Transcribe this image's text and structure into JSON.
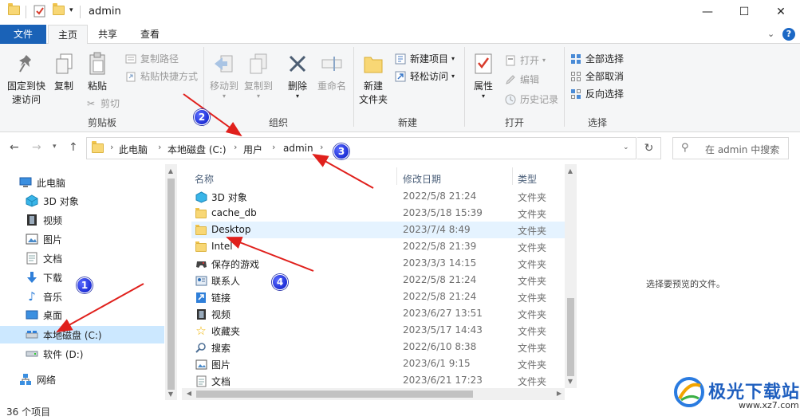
{
  "window": {
    "title": "admin",
    "controls": {
      "minimize": "—",
      "maximize": "☐",
      "close": "✕"
    }
  },
  "tabs": {
    "file": "文件",
    "home": "主页",
    "share": "共享",
    "view": "查看",
    "help": "?"
  },
  "ribbon": {
    "clipboard": {
      "pin": "固定到快\n速访问",
      "pin_l1": "固定到快",
      "pin_l2": "速访问",
      "copy": "复制",
      "paste": "粘贴",
      "copy_path": "复制路径",
      "paste_shortcut": "粘贴快捷方式",
      "cut": "剪切",
      "group": "剪贴板"
    },
    "organize": {
      "move_to": "移动到",
      "copy_to": "复制到",
      "delete": "删除",
      "rename": "重命名",
      "group": "组织"
    },
    "new": {
      "new_folder_l1": "新建",
      "new_folder_l2": "文件夹",
      "new_item": "新建项目",
      "easy_access": "轻松访问",
      "group": "新建"
    },
    "open": {
      "properties": "属性",
      "open": "打开",
      "edit": "编辑",
      "history": "历史记录",
      "group": "打开"
    },
    "select": {
      "select_all": "全部选择",
      "select_none": "全部取消",
      "invert": "反向选择",
      "group": "选择"
    }
  },
  "address": {
    "crumbs": [
      "此电脑",
      "本地磁盘 (C:)",
      "用户",
      "admin"
    ],
    "search_placeholder": "在 admin 中搜索"
  },
  "nav_pane": {
    "items": [
      {
        "label": "此电脑",
        "icon": "computer-icon"
      },
      {
        "label": "3D 对象",
        "icon": "3d-objects-icon"
      },
      {
        "label": "视频",
        "icon": "video-icon"
      },
      {
        "label": "图片",
        "icon": "pictures-icon"
      },
      {
        "label": "文档",
        "icon": "documents-icon"
      },
      {
        "label": "下载",
        "icon": "download-icon"
      },
      {
        "label": "音乐",
        "icon": "music-icon"
      },
      {
        "label": "桌面",
        "icon": "desktop-icon"
      },
      {
        "label": "本地磁盘 (C:)",
        "icon": "drive-icon",
        "selected": true
      },
      {
        "label": "软件 (D:)",
        "icon": "drive-icon"
      },
      {
        "label": "网络",
        "icon": "network-icon"
      }
    ]
  },
  "file_list": {
    "columns": {
      "name": "名称",
      "date": "修改日期",
      "type": "类型"
    },
    "rows": [
      {
        "name": "3D 对象",
        "date": "2022/5/8 21:24",
        "type": "文件夹",
        "icon": "3d-objects-icon"
      },
      {
        "name": "cache_db",
        "date": "2023/5/18 15:39",
        "type": "文件夹",
        "icon": "folder-icon"
      },
      {
        "name": "Desktop",
        "date": "2023/7/4 8:49",
        "type": "文件夹",
        "icon": "folder-icon",
        "hover": true
      },
      {
        "name": "Intel",
        "date": "2022/5/8 21:39",
        "type": "文件夹",
        "icon": "folder-icon"
      },
      {
        "name": "保存的游戏",
        "date": "2023/3/3 14:15",
        "type": "文件夹",
        "icon": "saved-games-icon"
      },
      {
        "name": "联系人",
        "date": "2022/5/8 21:24",
        "type": "文件夹",
        "icon": "contacts-icon"
      },
      {
        "name": "链接",
        "date": "2022/5/8 21:24",
        "type": "文件夹",
        "icon": "links-icon"
      },
      {
        "name": "视频",
        "date": "2023/6/27 13:51",
        "type": "文件夹",
        "icon": "video-icon"
      },
      {
        "name": "收藏夹",
        "date": "2023/5/17 14:43",
        "type": "文件夹",
        "icon": "favorites-icon"
      },
      {
        "name": "搜索",
        "date": "2022/6/10 8:38",
        "type": "文件夹",
        "icon": "search-icon"
      },
      {
        "name": "图片",
        "date": "2023/6/1 9:15",
        "type": "文件夹",
        "icon": "pictures-icon"
      },
      {
        "name": "文档",
        "date": "2023/6/21 17:23",
        "type": "文件夹",
        "icon": "documents-icon"
      }
    ]
  },
  "preview": {
    "text": "选择要预览的文件。"
  },
  "status": {
    "count": "36 个项目"
  },
  "annotations": {
    "badge1": "1",
    "badge2": "2",
    "badge3": "3",
    "badge4": "4",
    "arrow_color": "#e0201c"
  },
  "watermark": {
    "text": "极光下载站",
    "url": "www.xz7.com"
  }
}
